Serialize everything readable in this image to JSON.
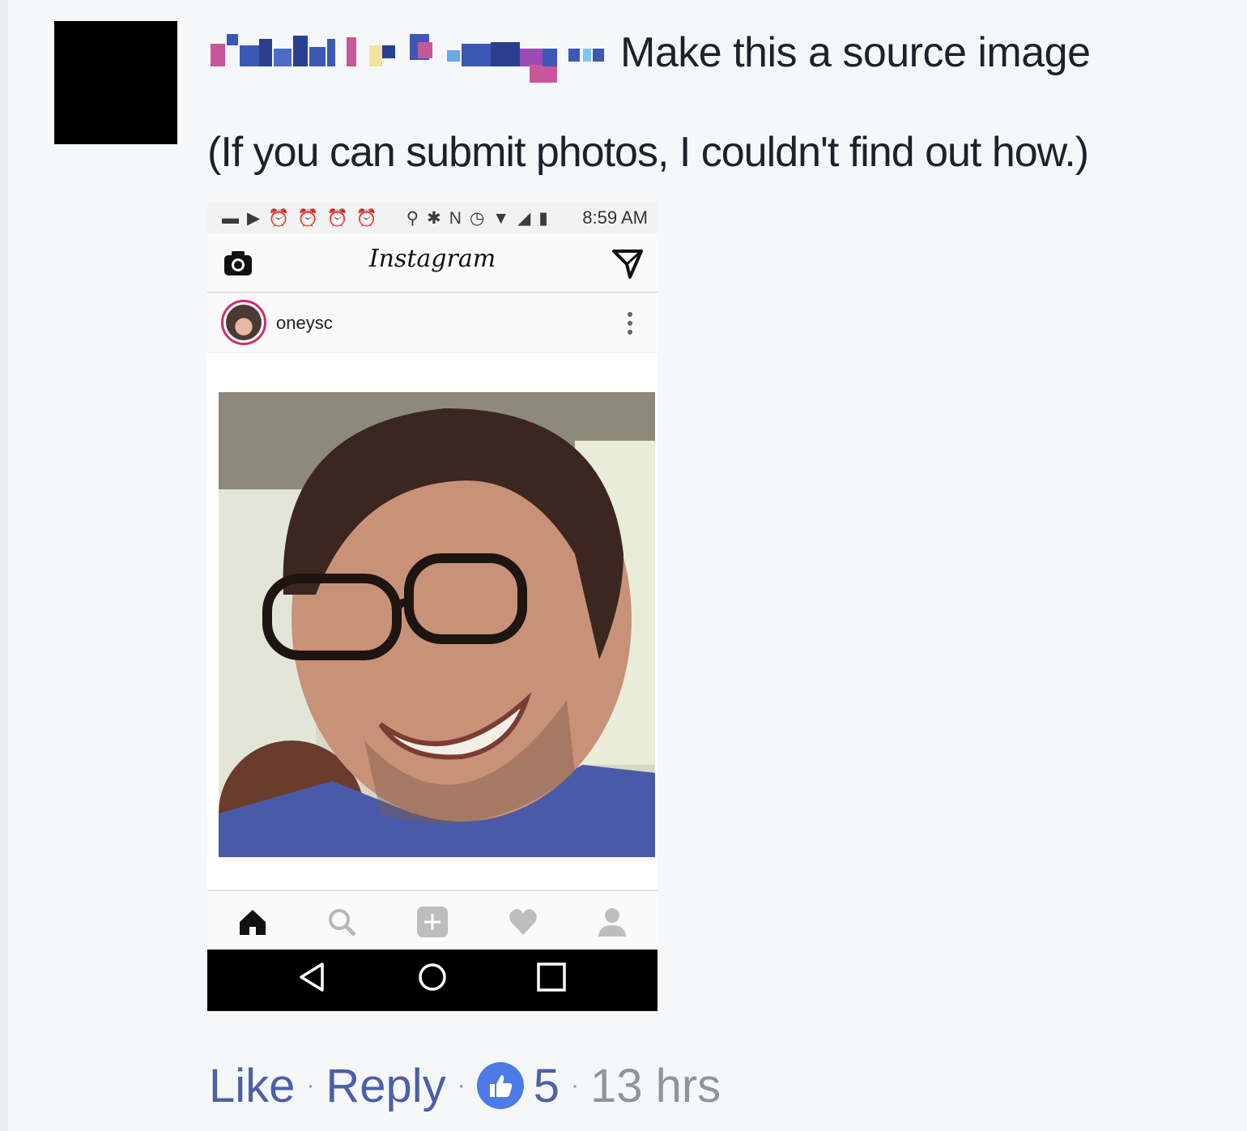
{
  "comment": {
    "author_name_redacted": "",
    "text": "Make this a source image",
    "subtext": "(If you can submit photos, I couldn't find out how.)"
  },
  "phone": {
    "status_time": "8:59 AM",
    "app_name": "Instagram",
    "post_username": "oneysc"
  },
  "actions": {
    "like_label": "Like",
    "separator": "·",
    "reply_label": "Reply",
    "reaction_count": "5",
    "time_ago": "13 hrs"
  },
  "colors": {
    "link": "#4b5faa",
    "meta": "#90949c",
    "like_badge": "#4c7be8"
  }
}
